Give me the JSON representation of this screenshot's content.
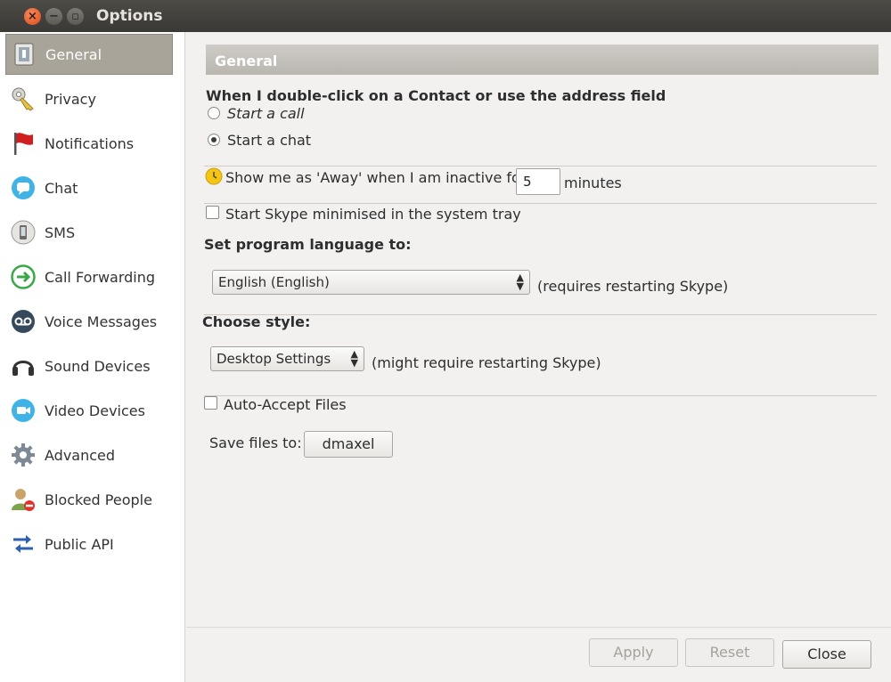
{
  "window": {
    "title": "Options"
  },
  "sidebar": {
    "items": [
      {
        "label": "General",
        "icon": "general-icon",
        "active": true
      },
      {
        "label": "Privacy",
        "icon": "key-icon"
      },
      {
        "label": "Notifications",
        "icon": "flag-icon"
      },
      {
        "label": "Chat",
        "icon": "chat-icon"
      },
      {
        "label": "SMS",
        "icon": "phone-icon"
      },
      {
        "label": "Call Forwarding",
        "icon": "forward-icon"
      },
      {
        "label": "Voice Messages",
        "icon": "voicemail-icon"
      },
      {
        "label": "Sound Devices",
        "icon": "headset-icon"
      },
      {
        "label": "Video Devices",
        "icon": "video-icon"
      },
      {
        "label": "Advanced",
        "icon": "gear-icon"
      },
      {
        "label": "Blocked People",
        "icon": "blocked-icon"
      },
      {
        "label": "Public API",
        "icon": "api-arrows-icon"
      }
    ]
  },
  "general": {
    "header": "General",
    "double_click": {
      "heading": "When I double-click on a Contact or use the address field",
      "option_call": "Start a call",
      "option_chat": "Start a chat",
      "selected": "Start a chat"
    },
    "away": {
      "label": "Show me as 'Away' when I am inactive for",
      "value": "5",
      "unit": "minutes"
    },
    "minimised": {
      "label": "Start Skype minimised in the system tray",
      "checked": false
    },
    "language": {
      "heading": "Set program language to:",
      "selected": "English (English)",
      "note": "(requires restarting Skype)"
    },
    "style": {
      "heading": "Choose style:",
      "selected": "Desktop Settings",
      "note": "(might require restarting Skype)"
    },
    "auto_accept": {
      "label": "Auto-Accept Files",
      "checked": false
    },
    "save_files": {
      "label": "Save files to:",
      "folder": "dmaxel"
    }
  },
  "footer": {
    "apply": "Apply",
    "reset": "Reset",
    "close": "Close"
  }
}
